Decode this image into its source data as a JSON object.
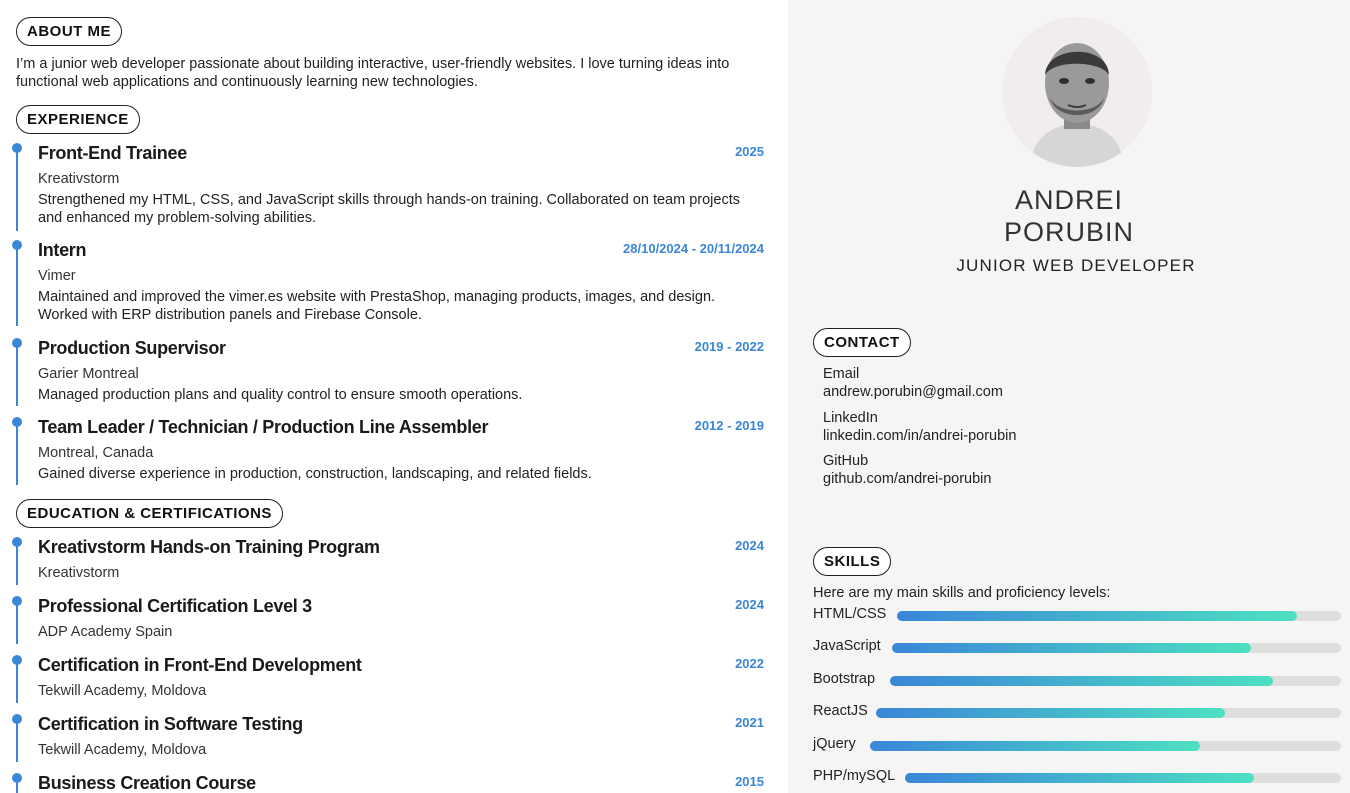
{
  "about": {
    "title": "ABOUT ME",
    "text": "I’m a junior web developer passionate about building interactive, user-friendly websites. I love turning ideas into functional web applications and continuously learning new technologies."
  },
  "experience": {
    "title": "EXPERIENCE",
    "items": [
      {
        "title": "Front-End Trainee",
        "date": "2025",
        "org": "Kreativstorm",
        "desc": "Strengthened my HTML, CSS, and JavaScript skills through hands-on training. Collaborated on team projects and enhanced my problem-solving abilities."
      },
      {
        "title": "Intern",
        "date": "28/10/2024 - 20/11/2024",
        "org": "Vimer",
        "desc": "Maintained and improved the vimer.es website with PrestaShop, managing products, images, and design. Worked with ERP distribution panels and Firebase Console."
      },
      {
        "title": "Production Supervisor",
        "date": "2019 - 2022",
        "org": "Garier Montreal",
        "desc": "Managed production plans and quality control to ensure smooth operations."
      },
      {
        "title": "Team Leader / Technician / Production Line Assembler",
        "date": "2012 - 2019",
        "org": "Montreal, Canada",
        "desc": "Gained diverse experience in production, construction, landscaping, and related fields."
      }
    ]
  },
  "education": {
    "title": "EDUCATION & CERTIFICATIONS",
    "items": [
      {
        "title": "Kreativstorm Hands-on Training Program",
        "date": "2024",
        "org": "Kreativstorm"
      },
      {
        "title": "Professional Certification Level 3",
        "date": "2024",
        "org": "ADP Academy Spain"
      },
      {
        "title": "Certification in Front-End Development",
        "date": "2022",
        "org": "Tekwill Academy, Moldova"
      },
      {
        "title": "Certification in Software Testing",
        "date": "2021",
        "org": "Tekwill Academy, Moldova"
      },
      {
        "title": "Business Creation Course",
        "date": "2015",
        "org": ""
      }
    ]
  },
  "profile": {
    "first_name": "ANDREI",
    "last_name": "PORUBIN",
    "role": "JUNIOR WEB DEVELOPER"
  },
  "contact": {
    "title": "CONTACT",
    "email_label": "Email",
    "email": "andrew.porubin@gmail.com",
    "linkedin_label": "LinkedIn",
    "linkedin": "linkedin.com/in/andrei-porubin",
    "github_label": "GitHub",
    "github": "github.com/andrei-porubin"
  },
  "skills": {
    "title": "SKILLS",
    "intro": "Here are my main skills and proficiency levels:",
    "items": [
      {
        "name": "HTML/CSS",
        "level": 0.9
      },
      {
        "name": "JavaScript",
        "level": 0.8
      },
      {
        "name": "Bootstrap",
        "level": 0.85
      },
      {
        "name": "ReactJS",
        "level": 0.75
      },
      {
        "name": "jQuery",
        "level": 0.7
      },
      {
        "name": "PHP/mySQL",
        "level": 0.8
      }
    ],
    "gradient_start": "#3a86d8",
    "gradient_end": "#4de0c2"
  },
  "colors": {
    "accent": "#3a86d8",
    "sidebar_bg": "#f5f5f5"
  }
}
